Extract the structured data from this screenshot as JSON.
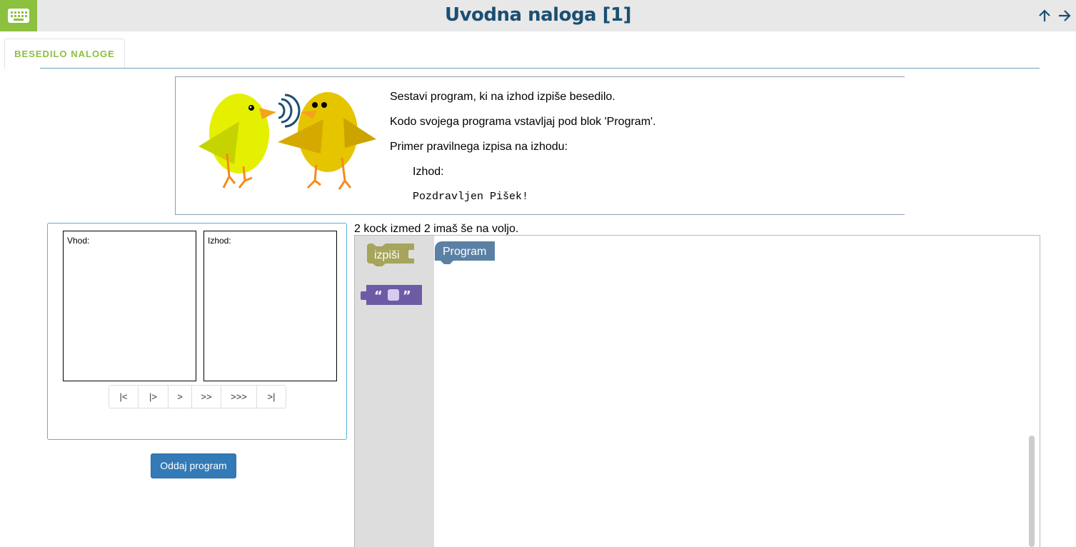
{
  "header": {
    "title": "Uvodna naloga [1]",
    "icons": {
      "keyboard": "keyboard-icon",
      "up": "arrow-up-icon",
      "right": "arrow-right-icon"
    },
    "accent": "#8cc03f",
    "title_color": "#1b4f72"
  },
  "tabs": [
    {
      "label": "BESEDILO NALOGE",
      "active": true
    }
  ],
  "task": {
    "lines": [
      "Sestavi program, ki na izhod izpiše besedilo.",
      "Kodo svojega programa vstavljaj pod blok 'Program'.",
      "Primer pravilnega izpisa na izhodu:"
    ],
    "output_label": "Izhod:",
    "output_example": "Pozdravljen Pišek!"
  },
  "io": {
    "input_label": "Vhod:",
    "output_label": "Izhod:",
    "stepper": [
      "|<",
      "|>",
      ">",
      ">>",
      ">>>",
      ">|"
    ],
    "submit_label": "Oddaj program"
  },
  "blockly": {
    "count_text": "2 kock izmed 2 imaš še na voljo.",
    "toolbox_print_label": "izpiši",
    "program_label": "Program",
    "colors": {
      "print": "#a5a55b",
      "text": "#6d5ba5",
      "program": "#5b80a5"
    }
  }
}
